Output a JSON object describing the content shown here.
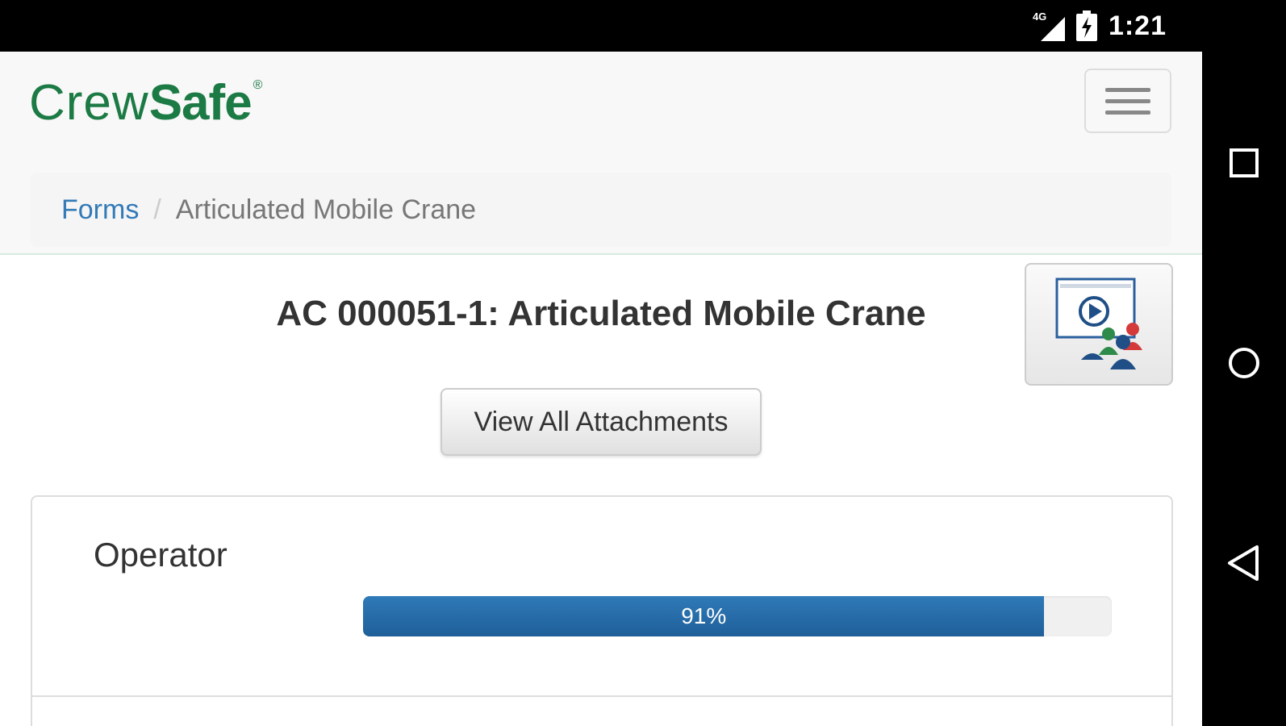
{
  "status_bar": {
    "network": "4G",
    "time": "1:21"
  },
  "navbar": {
    "brand_part1": "Crew",
    "brand_part2": "Safe",
    "brand_mark": "®"
  },
  "breadcrumb": {
    "link": "Forms",
    "separator": "/",
    "current": "Articulated Mobile Crane"
  },
  "form": {
    "title": "AC 000051-1: Articulated Mobile Crane",
    "attachments_button": "View All Attachments"
  },
  "sections": [
    {
      "label": "Operator",
      "progress_label": "91%",
      "progress_fraction": 0.91
    }
  ],
  "colors": {
    "brand_green": "#1c7a45",
    "link_blue": "#337ab7",
    "progress_blue": "#1f5f99"
  },
  "icons": {
    "menu": "hamburger-menu-icon",
    "video": "video-tutorial-icon",
    "recent": "square-icon",
    "home": "circle-icon",
    "back": "triangle-back-icon"
  }
}
